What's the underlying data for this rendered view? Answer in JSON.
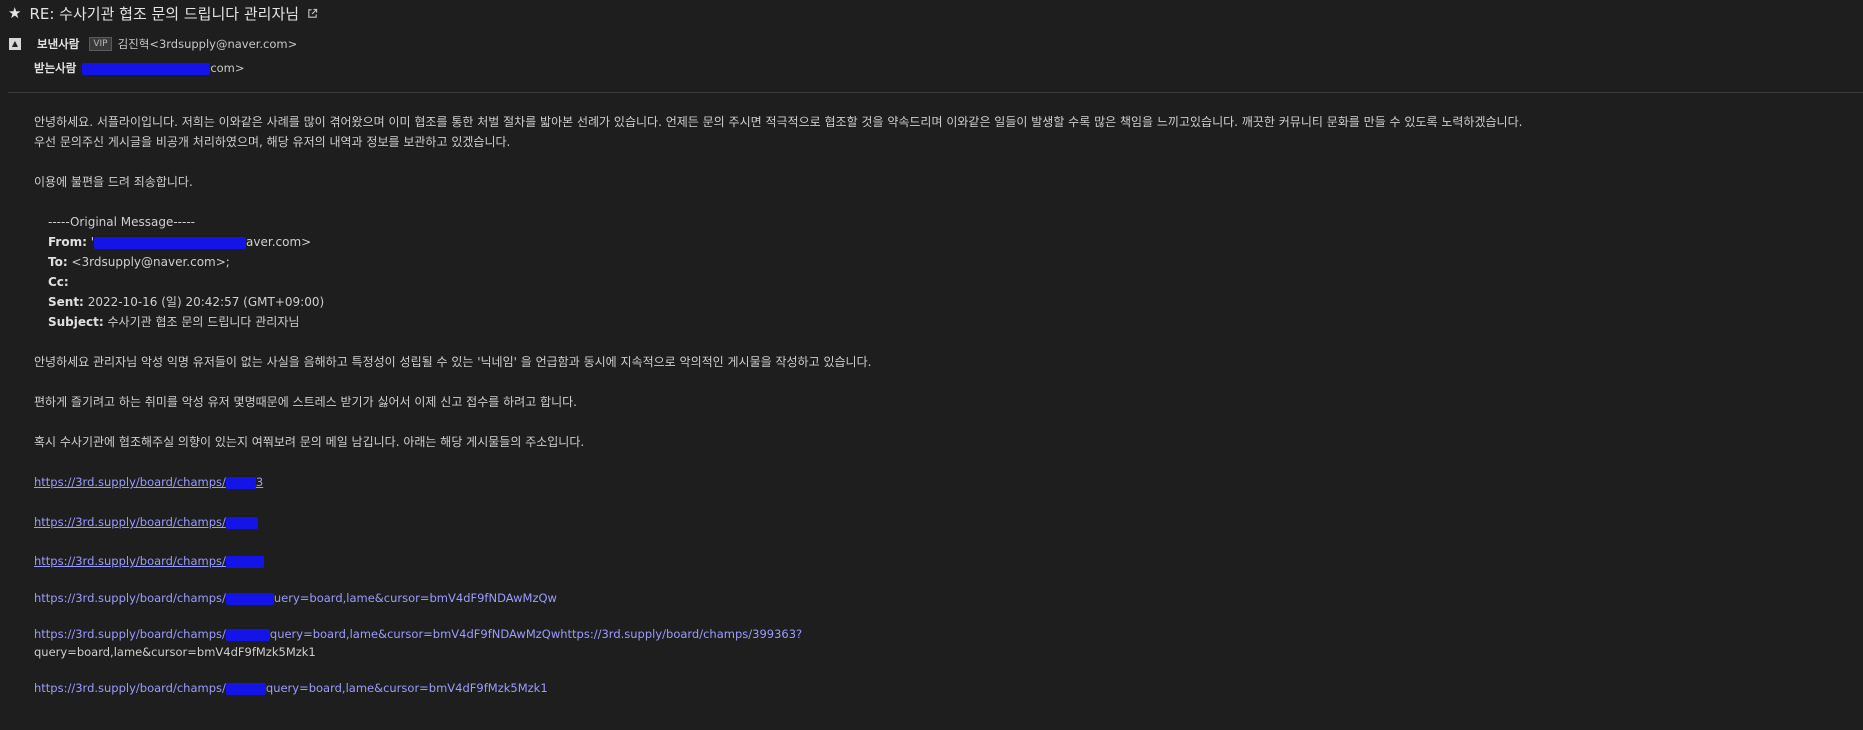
{
  "header": {
    "subject": "RE: 수사기관 협조 문의 드립니다 관리자님",
    "sender_label": "보낸사람",
    "vip_badge": "VIP",
    "sender": "김진혁<3rdsupply@naver.com>",
    "recipient_label": "받는사람",
    "recipient_tail": "com>"
  },
  "reply": {
    "line1": "안녕하세요. 서플라이입니다. 저희는 이와같은 사례를 많이 겪어왔으며 이미 협조를 통한 처벌 절차를 밟아본 선례가 있습니다. 언제든 문의 주시면 적극적으로 협조할 것을 약속드리며 이와같은 일들이 발생할 수록 많은 책임을 느끼고있습니다. 깨끗한 커뮤니티 문화를 만들 수 있도록 노력하겠습니다.",
    "line2": "우선 문의주신 게시글을 비공개 처리하였으며, 해당 유저의 내역과 정보를 보관하고 있겠습니다.",
    "line3": "이용에 불편을 드려 죄송합니다."
  },
  "original": {
    "marker": "-----Original Message-----",
    "from_label": "From:",
    "from_value_tail": "aver.com>",
    "to_label": "To:",
    "to_value": "<3rdsupply@naver.com>;",
    "cc_label": "Cc:",
    "sent_label": "Sent:",
    "sent_value": "2022-10-16 (일) 20:42:57 (GMT+09:00)",
    "subject_label": "Subject:",
    "subject_value": "수사기관 협조 문의 드립니다 관리자님"
  },
  "message": {
    "p1": "안녕하세요 관리자님 악성 익명 유저들이 없는 사실을 음해하고 특정성이 성립될 수 있는 '닉네임' 을 언급함과 동시에 지속적으로 악의적인 게시물을 작성하고 있습니다.",
    "p2": "편하게 즐기려고 하는 취미를 악성 유저 몇명때문에 스트레스 받기가 싫어서 이제 신고 접수를 하려고 합니다.",
    "p3": "혹시 수사기관에 협조해주실 의향이 있는지 여쭤보려 문의 메일 남깁니다. 아래는 해당 게시물들의 주소입니다."
  },
  "links": [
    {
      "text": "https://3rd.supply/board/champs/",
      "tail": "3"
    },
    {
      "text": "https://3rd.supply/board/champs/",
      "tail": ""
    },
    {
      "text": "https://3rd.supply/board/champs/",
      "tail": ""
    },
    {
      "text": "https://3rd.supply/board/champs/",
      "tail": "uery=board,lame&cursor=bmV4dF9fNDAwMzQw"
    },
    {
      "text": "https://3rd.supply/board/champs/",
      "tail": "query=board,lame&cursor=bmV4dF9fNDAwMzQwhttps://3rd.supply/board/champs/399363?",
      "wrap": "query=board,lame&cursor=bmV4dF9fMzk5Mzk1"
    },
    {
      "text": "https://3rd.supply/board/champs/",
      "tail": "query=board,lame&cursor=bmV4dF9fMzk5Mzk1"
    }
  ],
  "colors": {
    "background": "#1e1e1e",
    "link": "#9a9cff",
    "redaction": "#1414e8"
  }
}
